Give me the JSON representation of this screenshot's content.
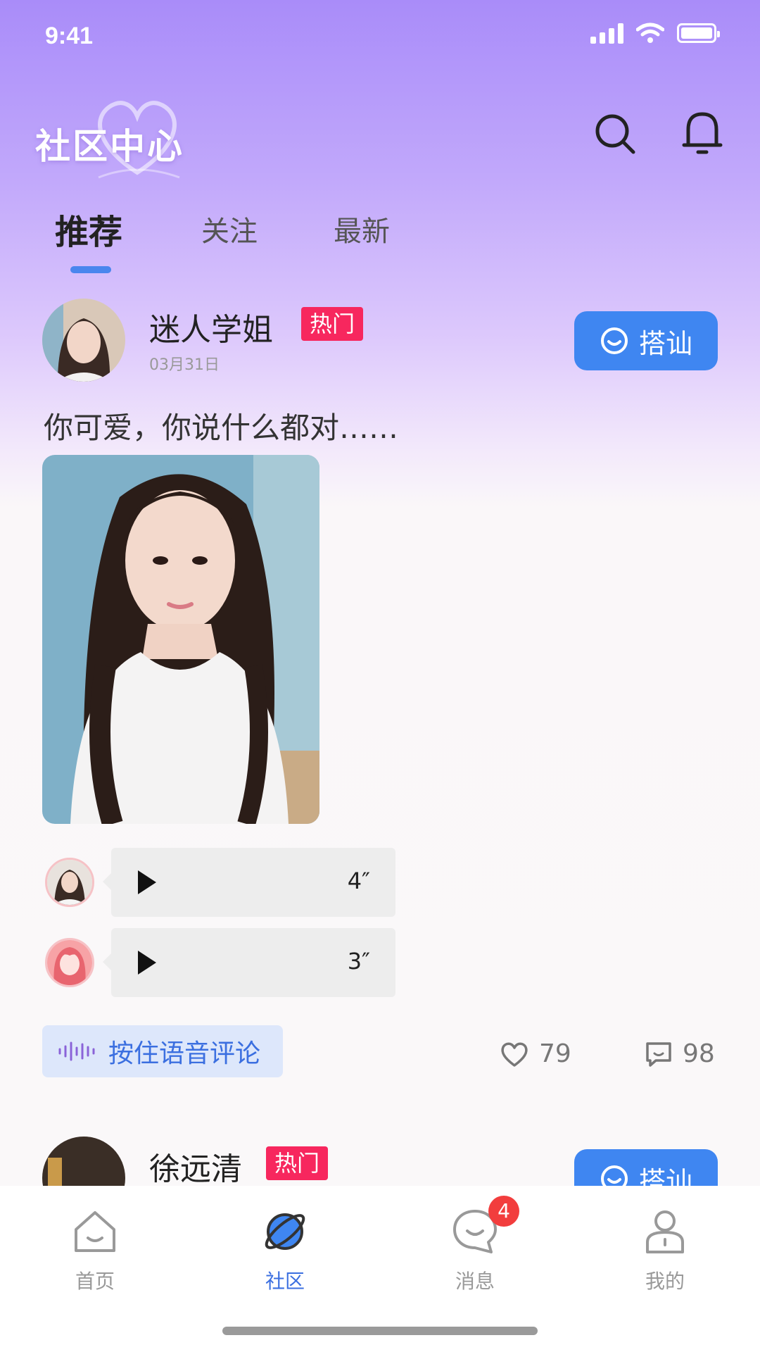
{
  "status_bar": {
    "time": "9:41"
  },
  "header": {
    "title": "社区中心"
  },
  "tabs": [
    {
      "label": "推荐",
      "active": true
    },
    {
      "label": "关注",
      "active": false
    },
    {
      "label": "最新",
      "active": false
    }
  ],
  "posts": [
    {
      "author": "迷人学姐",
      "badge": "热门",
      "date": "03月31日",
      "chat_label": "搭讪",
      "text": "你可爱，你说什么都对……",
      "voices": [
        {
          "duration": "4″"
        },
        {
          "duration": "3″"
        }
      ],
      "voice_comment_label": "按住语音评论",
      "likes": "79",
      "comments": "98"
    },
    {
      "author": "徐远清",
      "badge": "热门",
      "chat_label": "搭讪"
    }
  ],
  "bottom_nav": [
    {
      "label": "首页",
      "icon": "home-icon",
      "active": false
    },
    {
      "label": "社区",
      "icon": "planet-icon",
      "active": true
    },
    {
      "label": "消息",
      "icon": "message-icon",
      "active": false,
      "badge": "4"
    },
    {
      "label": "我的",
      "icon": "profile-icon",
      "active": false
    }
  ],
  "colors": {
    "accent": "#3f86f1",
    "hot_badge": "#f7275e",
    "notification_badge": "#f23d3d",
    "header_gradient_top": "#a98cf9"
  }
}
